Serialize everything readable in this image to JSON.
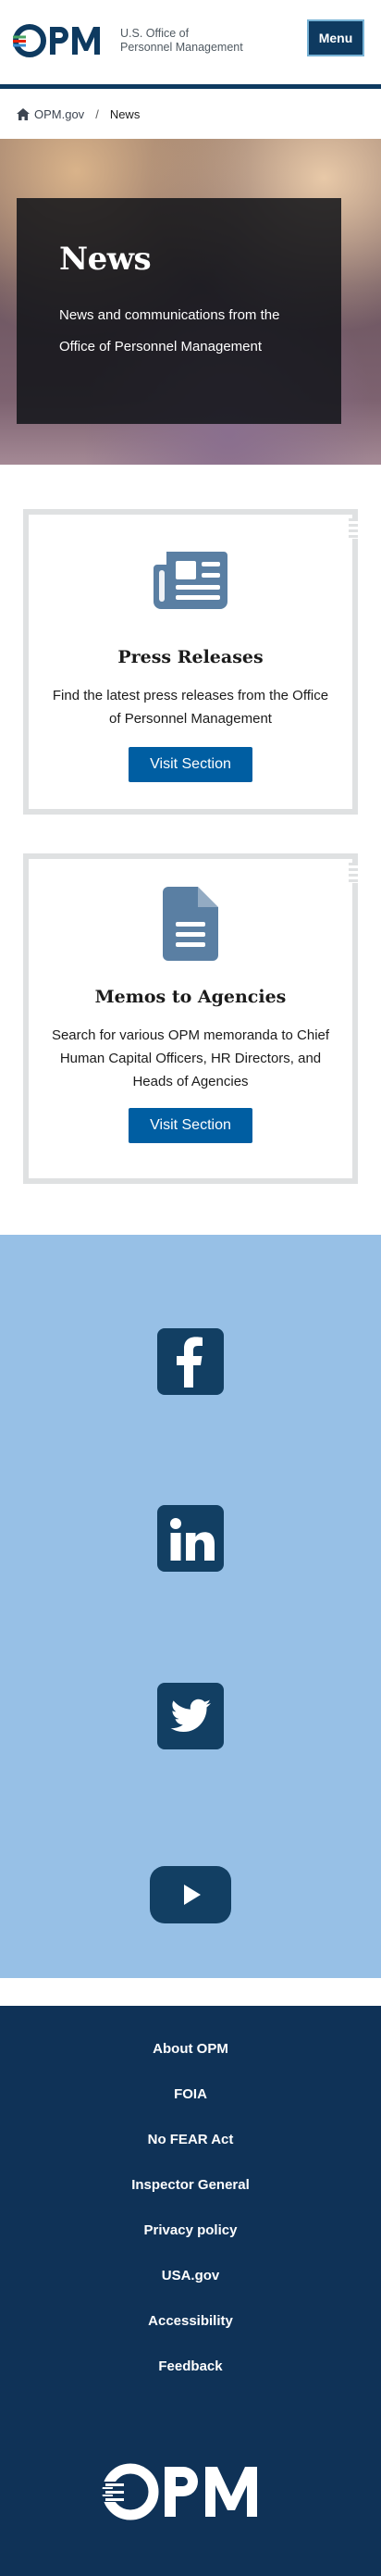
{
  "header": {
    "logo_text_line1": "U.S. Office of",
    "logo_text_line2": "Personnel Management",
    "menu_label": "Menu",
    "brand_color": "#0e3a60"
  },
  "breadcrumb": {
    "home_label": "OPM.gov",
    "separator": "/",
    "current": "News"
  },
  "hero": {
    "title": "News",
    "subtitle": "News and communications from the Office of Personnel Management"
  },
  "cards": [
    {
      "icon": "newspaper-icon",
      "title": "Press Releases",
      "description": "Find the latest press releases from the Office of Personnel Management",
      "button_label": "Visit Section"
    },
    {
      "icon": "document-icon",
      "title": "Memos to Agencies",
      "description": "Search for various OPM memoranda to Chief Human Capital Officers, HR Directors, and Heads of Agencies",
      "button_label": "Visit Section"
    }
  ],
  "social": {
    "items": [
      "facebook-icon",
      "linkedin-icon",
      "twitter-icon",
      "youtube-icon"
    ],
    "background": "#97c0e6",
    "icon_color": "#123f63"
  },
  "footer": {
    "links": [
      "About OPM",
      "FOIA",
      "No FEAR Act",
      "Inspector General",
      "Privacy policy",
      "USA.gov",
      "Accessibility",
      "Feedback"
    ],
    "background": "#0f3257"
  },
  "colors": {
    "button_blue": "#005ea2",
    "card_border": "#dfe1e2",
    "icon_slate": "#5a7fa3"
  }
}
